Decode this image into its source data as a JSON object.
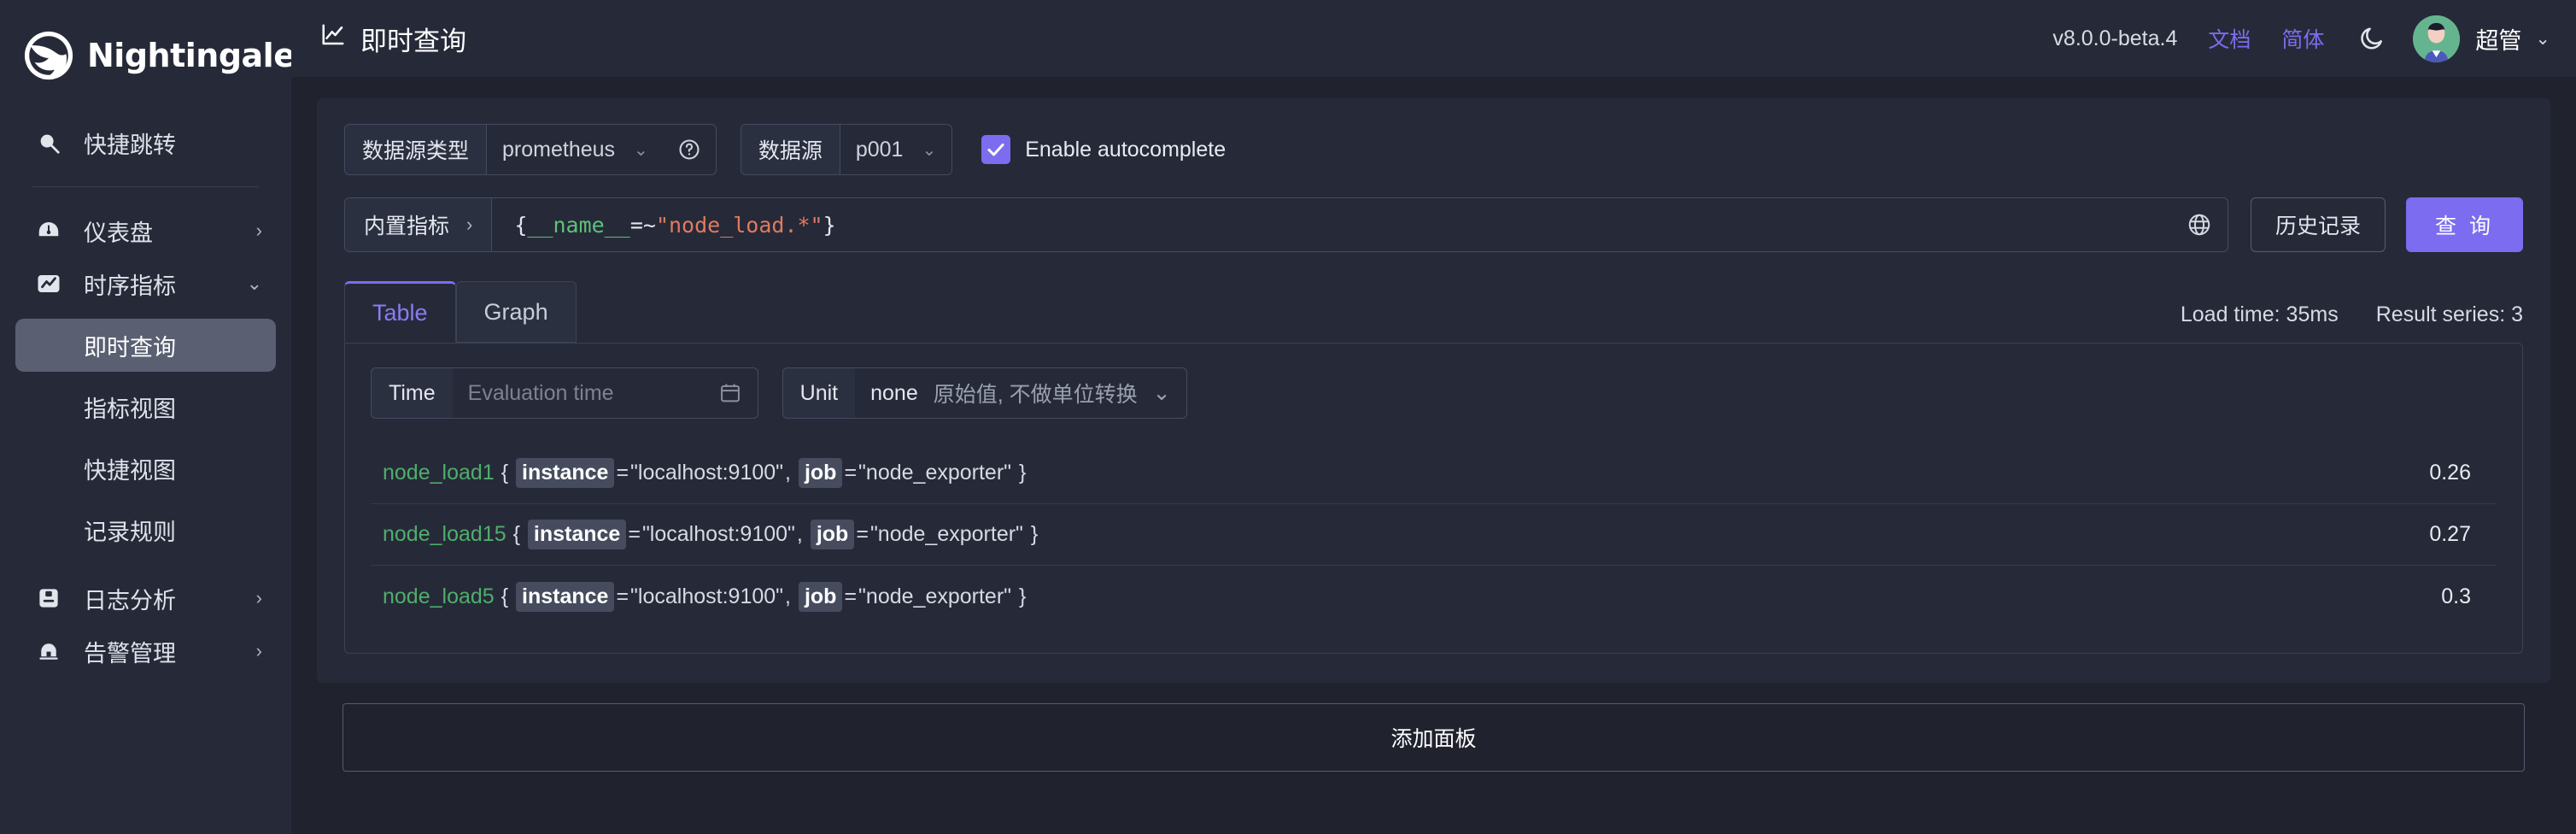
{
  "brand": {
    "name": "Nightingale",
    "logo_icon": "nightingale-bird-icon"
  },
  "sidebar": {
    "quick_jump": {
      "label": "快捷跳转",
      "icon": "search-icon"
    },
    "items": [
      {
        "label": "仪表盘",
        "icon": "dashboard-gauge-icon",
        "chevron": "›"
      },
      {
        "label": "时序指标",
        "icon": "metrics-chart-icon",
        "chevron": "⌄"
      },
      {
        "label": "日志分析",
        "icon": "log-analysis-icon",
        "chevron": "›"
      },
      {
        "label": "告警管理",
        "icon": "alert-bell-icon",
        "chevron": "›"
      }
    ],
    "sub_items": [
      {
        "label": "即时查询",
        "active": true
      },
      {
        "label": "指标视图",
        "active": false
      },
      {
        "label": "快捷视图",
        "active": false
      },
      {
        "label": "记录规则",
        "active": false
      }
    ]
  },
  "topbar": {
    "title": "即时查询",
    "title_icon": "chart-line-icon",
    "version": "v8.0.0-beta.4",
    "docs_link": "文档",
    "lang_link": "简体",
    "theme_icon": "moon-icon",
    "avatar_icon": "user-avatar",
    "username": "超管",
    "user_chevron": "⌄"
  },
  "query": {
    "datasource_type_label": "数据源类型",
    "datasource_type_value": "prometheus",
    "help_icon": "question-circle-icon",
    "datasource_label": "数据源",
    "datasource_value": "p001",
    "autocomplete_label": "Enable autocomplete",
    "autocomplete_checked": true,
    "builtin_metrics_label": "内置指标",
    "builtin_metrics_chevron": "›",
    "expression": "{__name__=~\"node_load.*\"}",
    "expr_tokens": {
      "open": "{",
      "name": "__name__",
      "op": "=~",
      "value": "\"node_load.*\"",
      "close": "}"
    },
    "globe_icon": "globe-icon",
    "history_button": "历史记录",
    "run_button": "查 询"
  },
  "results": {
    "tabs": [
      {
        "label": "Table",
        "active": true
      },
      {
        "label": "Graph",
        "active": false
      }
    ],
    "load_time": "Load time: 35ms",
    "result_series": "Result series: 3",
    "time_label": "Time",
    "time_placeholder": "Evaluation time",
    "calendar_icon": "calendar-icon",
    "unit_label": "Unit",
    "unit_value": "none",
    "unit_desc": "原始值, 不做单位转换",
    "unit_chevron": "⌄",
    "rows": [
      {
        "metric": "node_load1",
        "labels": [
          {
            "key": "instance",
            "value": "\"localhost:9100\""
          },
          {
            "key": "job",
            "value": "\"node_exporter\""
          }
        ],
        "value": "0.26"
      },
      {
        "metric": "node_load15",
        "labels": [
          {
            "key": "instance",
            "value": "\"localhost:9100\""
          },
          {
            "key": "job",
            "value": "\"node_exporter\""
          }
        ],
        "value": "0.27"
      },
      {
        "metric": "node_load5",
        "labels": [
          {
            "key": "instance",
            "value": "\"localhost:9100\""
          },
          {
            "key": "job",
            "value": "\"node_exporter\""
          }
        ],
        "value": "0.3"
      }
    ]
  },
  "footer": {
    "add_panel_label": "添加面板"
  },
  "colors": {
    "page_bg": "#20232e",
    "panel_bg": "#262a38",
    "accent_purple": "#7c6cf0",
    "metric_green": "#4fae6b",
    "string_orange": "#e07a5f",
    "avatar_green": "#65b490"
  }
}
